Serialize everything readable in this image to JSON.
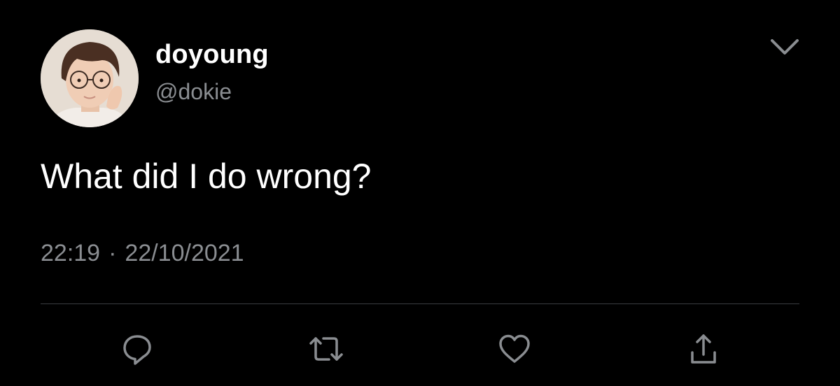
{
  "tweet": {
    "display_name": "doyoung",
    "handle": "@dokie",
    "text": "What did I do wrong?",
    "time": "22:19",
    "separator": "·",
    "date": "22/10/2021"
  },
  "icons": {
    "menu": "chevron-down-icon",
    "reply": "reply-icon",
    "retweet": "retweet-icon",
    "like": "heart-icon",
    "share": "share-icon"
  },
  "colors": {
    "background": "#000000",
    "primary_text": "#ffffff",
    "secondary_text": "#8a8d91",
    "icon": "#8a8d91",
    "divider": "#3a3d40"
  }
}
